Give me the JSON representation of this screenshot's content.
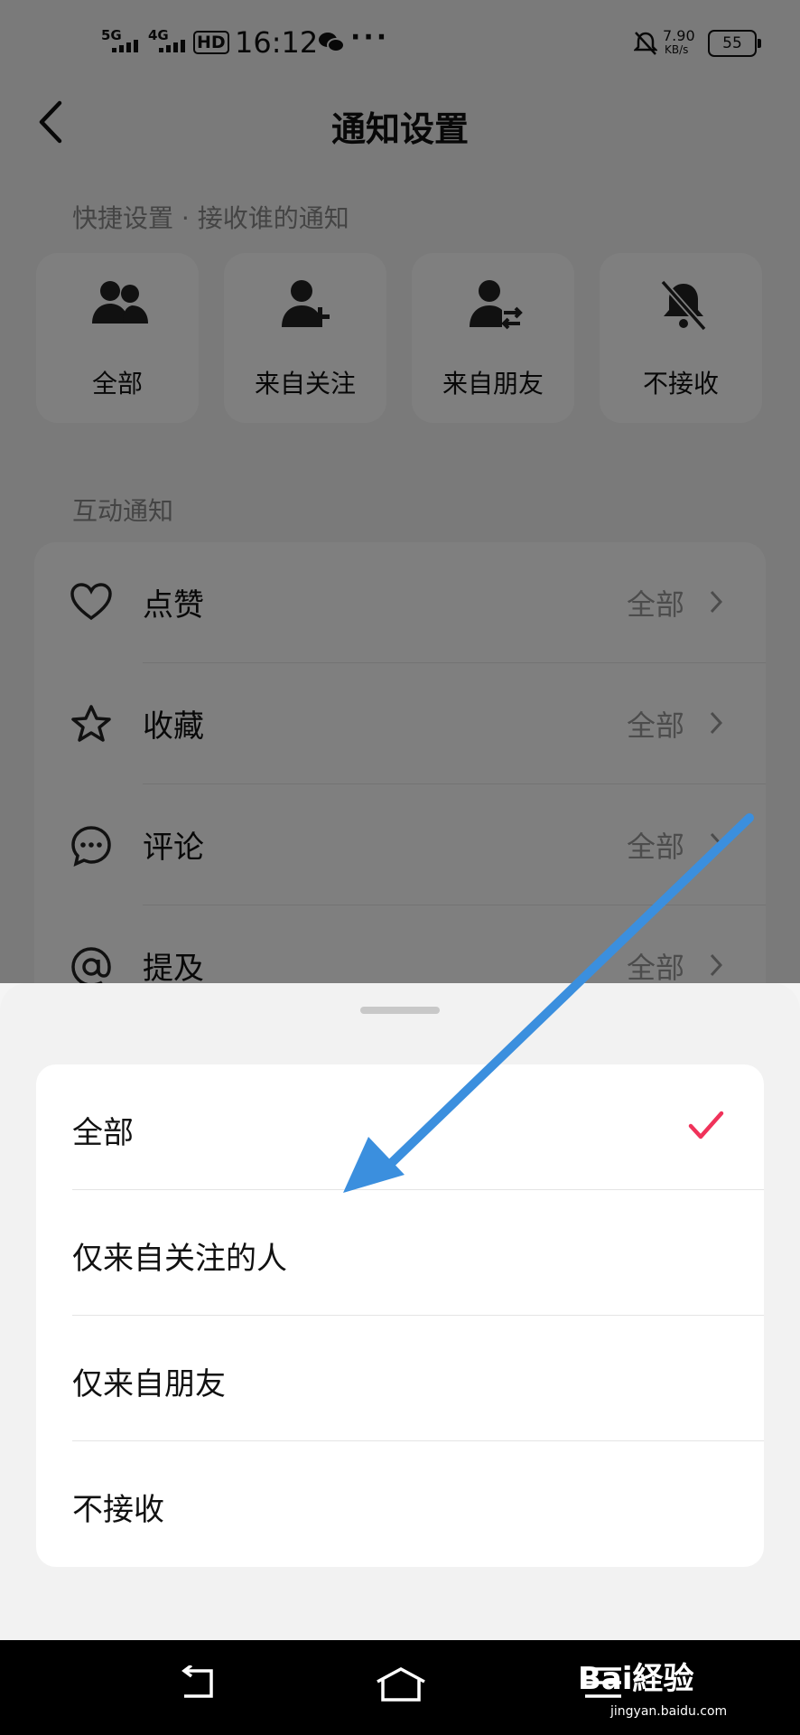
{
  "status_bar": {
    "network1": "5G",
    "network2": "4G",
    "hd_badge": "HD",
    "time": "16:12",
    "speed_value": "7.90",
    "speed_unit": "KB/s",
    "battery": "55"
  },
  "header": {
    "title": "通知设置"
  },
  "quick": {
    "label": "快捷设置 · 接收谁的通知",
    "items": [
      {
        "label": "全部",
        "icon": "people-icon"
      },
      {
        "label": "来自关注",
        "icon": "user-plus-icon"
      },
      {
        "label": "来自朋友",
        "icon": "user-swap-icon"
      },
      {
        "label": "不接收",
        "icon": "bell-off-icon"
      }
    ]
  },
  "interaction": {
    "label": "互动通知",
    "rows": [
      {
        "label": "点赞",
        "value": "全部",
        "icon": "heart-icon"
      },
      {
        "label": "收藏",
        "value": "全部",
        "icon": "star-icon"
      },
      {
        "label": "评论",
        "value": "全部",
        "icon": "comment-icon"
      },
      {
        "label": "提及",
        "value": "全部",
        "icon": "at-icon"
      }
    ]
  },
  "sheet": {
    "options": [
      {
        "label": "全部",
        "selected": true
      },
      {
        "label": "仅来自关注的人",
        "selected": false
      },
      {
        "label": "仅来自朋友",
        "selected": false
      },
      {
        "label": "不接收",
        "selected": false
      }
    ],
    "check_color": "#f0325a"
  },
  "watermark": {
    "brand": "Bai経验",
    "site": "jingyan.baidu.com"
  },
  "colors": {
    "arrow": "#3b8fde"
  }
}
